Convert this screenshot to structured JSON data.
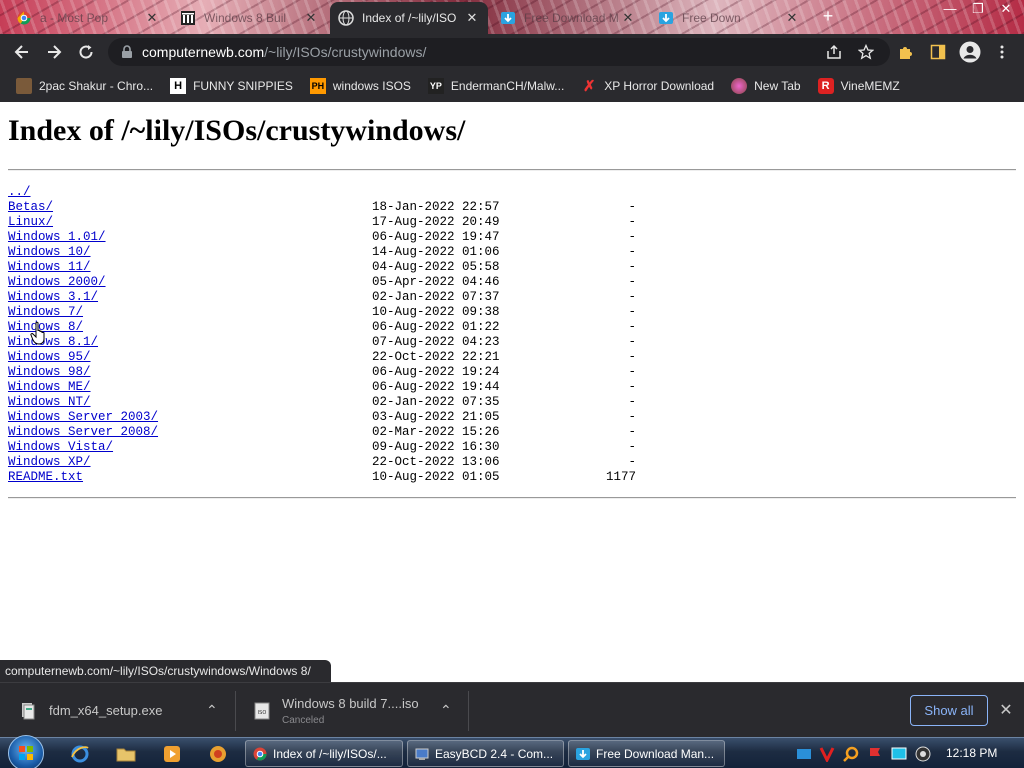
{
  "tabs": [
    {
      "title": "a - Most Pop",
      "active": false,
      "icon": "chrome-icon"
    },
    {
      "title": "Windows 8 Buil",
      "active": false,
      "icon": "museum-icon"
    },
    {
      "title": "Index of /~lily/ISO",
      "active": true,
      "icon": "globe-icon"
    },
    {
      "title": "Free Download M",
      "active": false,
      "icon": "fdm-icon"
    },
    {
      "title": "Free Down",
      "active": false,
      "icon": "fdm-icon"
    }
  ],
  "new_tab_label": "+",
  "address": {
    "host": "computernewb.com",
    "path": "/~lily/ISOs/crustywindows/"
  },
  "bookmarks": [
    {
      "label": "2pac Shakur - Chro...",
      "icon": "bookmark-icon-2pac"
    },
    {
      "label": "FUNNY SNIPPIES",
      "icon": "bookmark-icon-h"
    },
    {
      "label": "windows ISOS",
      "icon": "bookmark-icon-ph"
    },
    {
      "label": "EndermanCH/Malw...",
      "icon": "bookmark-icon-yp"
    },
    {
      "label": "XP Horror Download",
      "icon": "bookmark-icon-x"
    },
    {
      "label": "New Tab",
      "icon": "bookmark-icon-newtab"
    },
    {
      "label": "VineMEMZ",
      "icon": "bookmark-icon-r"
    }
  ],
  "page": {
    "title": "Index of /~lily/ISOs/crustywindows/",
    "entries": [
      {
        "name": "../",
        "date": "",
        "size": ""
      },
      {
        "name": "Betas/",
        "date": "18-Jan-2022 22:57",
        "size": "-"
      },
      {
        "name": "Linux/",
        "date": "17-Aug-2022 20:49",
        "size": "-"
      },
      {
        "name": "Windows 1.01/",
        "date": "06-Aug-2022 19:47",
        "size": "-"
      },
      {
        "name": "Windows 10/",
        "date": "14-Aug-2022 01:06",
        "size": "-"
      },
      {
        "name": "Windows 11/",
        "date": "04-Aug-2022 05:58",
        "size": "-"
      },
      {
        "name": "Windows 2000/",
        "date": "05-Apr-2022 04:46",
        "size": "-"
      },
      {
        "name": "Windows 3.1/",
        "date": "02-Jan-2022 07:37",
        "size": "-"
      },
      {
        "name": "Windows 7/",
        "date": "10-Aug-2022 09:38",
        "size": "-"
      },
      {
        "name": "Windows 8/",
        "date": "06-Aug-2022 01:22",
        "size": "-"
      },
      {
        "name": "Windows 8.1/",
        "date": "07-Aug-2022 04:23",
        "size": "-"
      },
      {
        "name": "Windows 95/",
        "date": "22-Oct-2022 22:21",
        "size": "-"
      },
      {
        "name": "Windows 98/",
        "date": "06-Aug-2022 19:24",
        "size": "-"
      },
      {
        "name": "Windows ME/",
        "date": "06-Aug-2022 19:44",
        "size": "-"
      },
      {
        "name": "Windows NT/",
        "date": "02-Jan-2022 07:35",
        "size": "-"
      },
      {
        "name": "Windows Server 2003/",
        "date": "03-Aug-2022 21:05",
        "size": "-"
      },
      {
        "name": "Windows Server 2008/",
        "date": "02-Mar-2022 15:26",
        "size": "-"
      },
      {
        "name": "Windows Vista/",
        "date": "09-Aug-2022 16:30",
        "size": "-"
      },
      {
        "name": "Windows XP/",
        "date": "22-Oct-2022 13:06",
        "size": "-"
      },
      {
        "name": "README.txt",
        "date": "10-Aug-2022 01:05",
        "size": "1177"
      }
    ]
  },
  "status_url": "computernewb.com/~lily/ISOs/crustywindows/Windows 8/",
  "downloads": [
    {
      "name": "fdm_x64_setup.exe",
      "status": ""
    },
    {
      "name": "Windows 8 build 7....iso",
      "status": "Canceled"
    }
  ],
  "show_all_label": "Show all",
  "taskbar": {
    "tasks": [
      {
        "label": "Index of /~lily/ISOs/...",
        "icon": "chrome-icon"
      },
      {
        "label": "EasyBCD 2.4 - Com...",
        "icon": "easybcd-icon"
      },
      {
        "label": "Free Download Man...",
        "icon": "fdm-icon"
      }
    ],
    "clock": "12:18 PM"
  },
  "colors": {
    "chrome_dark": "#2a2a2e",
    "link": "#0000cc",
    "accent_blue": "#8ab4f8"
  }
}
